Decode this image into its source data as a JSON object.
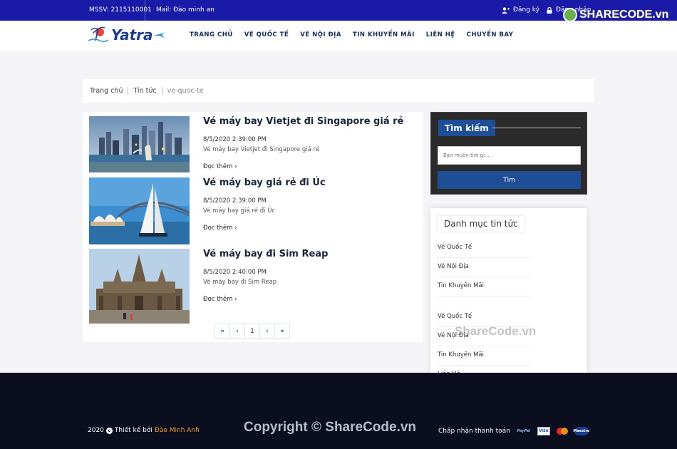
{
  "topbar": {
    "mssv": "MSSV: 2115110001",
    "mail": "Mail: Đào minh an",
    "register": "Đăng ký",
    "login": "Đăng nhập"
  },
  "watermark": {
    "badge": "SHARECODE.vn",
    "middle": "ShareCode.vn",
    "footer": "Copyright © ShareCode.vn"
  },
  "header": {
    "logo_text": "Yatra",
    "nav": [
      "TRANG CHỦ",
      "VÉ QUỐC TẾ",
      "VÉ NỘI ĐỊA",
      "TIN KHUYẾN MÃI",
      "LIÊN HỆ",
      "CHUYẾN BAY"
    ]
  },
  "breadcrumb": [
    "Trang chủ",
    "Tin tức",
    "ve-quoc-te"
  ],
  "news": [
    {
      "title": "Vé máy bay Vietjet đi Singapore giá rẻ",
      "date": "8/5/2020 2:39:00 PM",
      "summary": "Vé máy bay Vietjet đi Singapore giá rẻ",
      "more": "Đọc thêm ›",
      "image": "singapore-merlion-photo"
    },
    {
      "title": "Vé máy bay giá rẻ đi Úc",
      "date": "8/5/2020 2:39:00 PM",
      "summary": "Vé máy bay giá rẻ đi Úc",
      "more": "Đọc thêm ›",
      "image": "sydney-opera-house-photo"
    },
    {
      "title": "Vé máy bay đi Sim Reap",
      "date": "8/5/2020 2:40:00 PM",
      "summary": "Vé máy bay đi Sim Reap",
      "more": "Đọc thêm ›",
      "image": "angkor-wat-photo"
    }
  ],
  "pagination": {
    "first": "«",
    "prev": "‹",
    "current": "1",
    "next": "›",
    "last": "»"
  },
  "search": {
    "title": "Tìm kiếm",
    "placeholder": "Bạn muốn tìm gì...",
    "button": "Tìm"
  },
  "categories": {
    "title": "Danh mục tin tức",
    "items": [
      "Vé Quốc Tế",
      "Vé Nội Địa",
      "Tin Khuyến Mãi",
      "Vé Quốc Tế",
      "Vé Nội Địa",
      "Tin Khuyến Mãi",
      "Liên Hệ"
    ]
  },
  "footer": {
    "year": "2020",
    "designed_by": "Thiết kế bởi",
    "author": "Đào Minh Anh",
    "payment_label": "Chấp nhận thanh toán",
    "payments": [
      "PayPal",
      "VISA",
      "MasterCard",
      "Maestro"
    ]
  },
  "colors": {
    "topbar": "#1a1aa8",
    "brand_blue": "#1e4f96",
    "footer": "#0a0e1f",
    "author": "#f0a030"
  }
}
